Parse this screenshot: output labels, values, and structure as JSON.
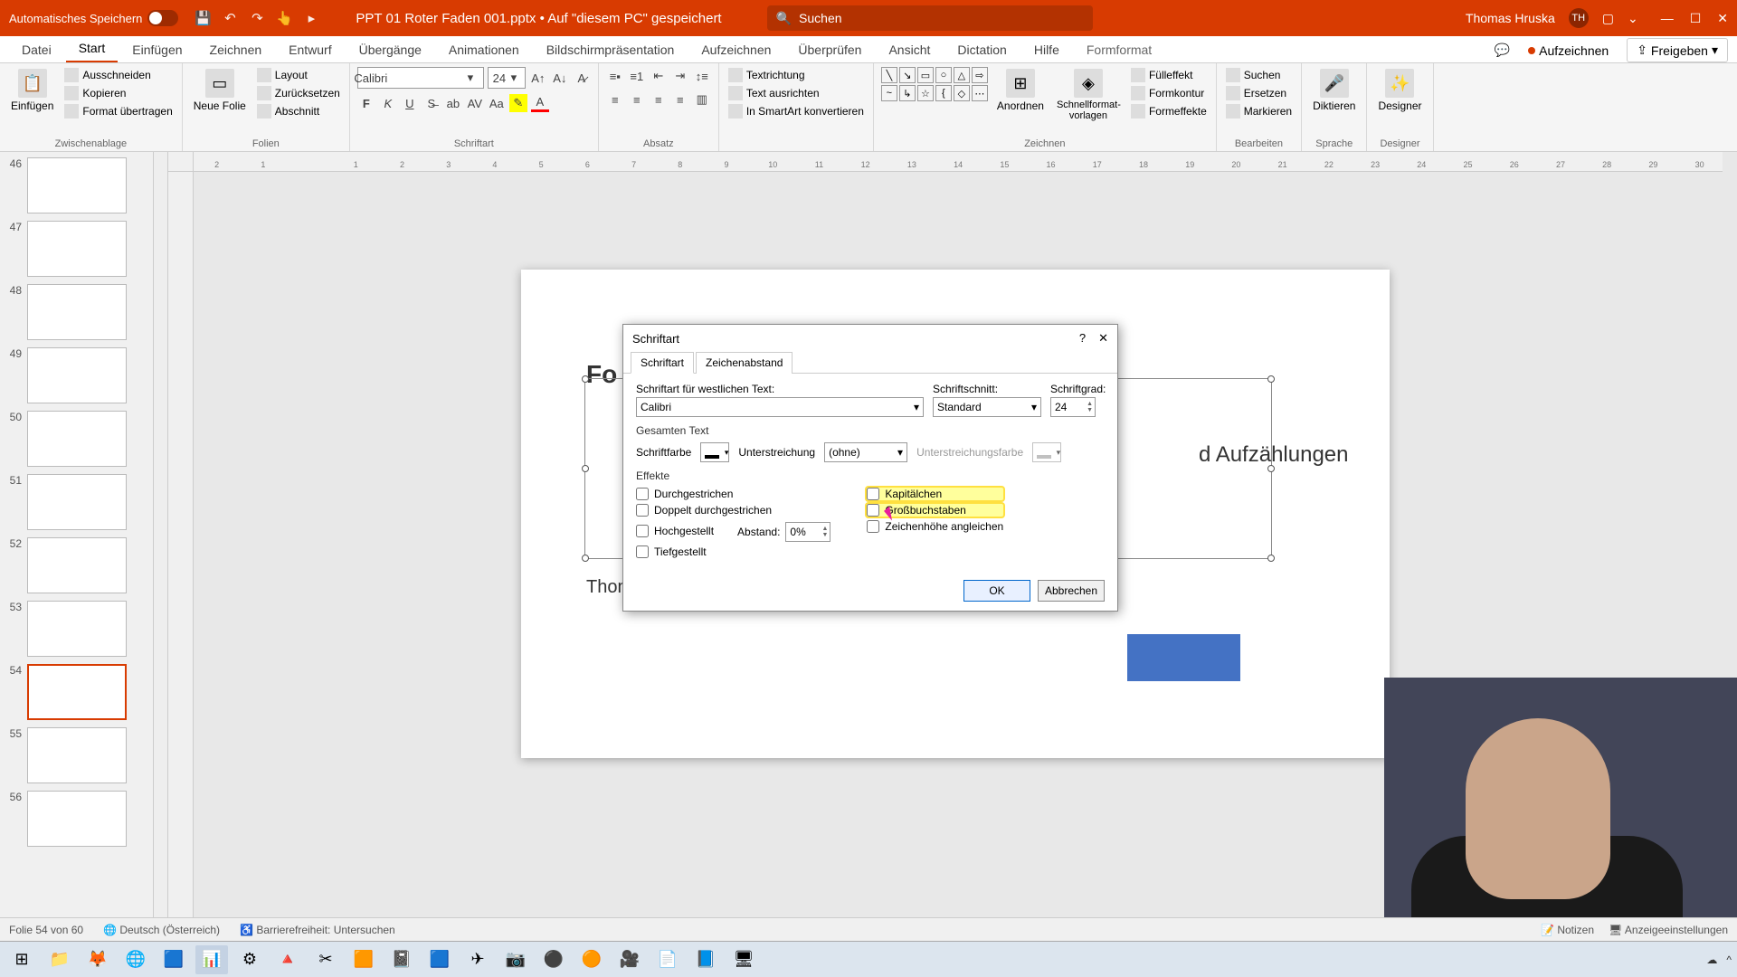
{
  "titlebar": {
    "autosave_label": "Automatisches Speichern",
    "doc_name": "PPT 01 Roter Faden 001.pptx • Auf \"diesem PC\" gespeichert",
    "search_placeholder": "Suchen",
    "user_name": "Thomas Hruska",
    "user_initials": "TH"
  },
  "ribbon_tabs": [
    "Datei",
    "Start",
    "Einfügen",
    "Zeichnen",
    "Entwurf",
    "Übergänge",
    "Animationen",
    "Bildschirmpräsentation",
    "Aufzeichnen",
    "Überprüfen",
    "Ansicht",
    "Dictation",
    "Hilfe",
    "Formformat"
  ],
  "ribbon_actions": {
    "record": "Aufzeichnen",
    "share": "Freigeben"
  },
  "ribbon": {
    "paste": "Einfügen",
    "cut": "Ausschneiden",
    "copy": "Kopieren",
    "format_painter": "Format übertragen",
    "clipboard_label": "Zwischenablage",
    "new_slide": "Neue Folie",
    "layout": "Layout",
    "reset": "Zurücksetzen",
    "section": "Abschnitt",
    "slides_label": "Folien",
    "font_name": "Calibri",
    "font_size": "24",
    "font_label": "Schriftart",
    "paragraph_label": "Absatz",
    "text_direction": "Textrichtung",
    "align_text": "Text ausrichten",
    "convert_smartart": "In SmartArt konvertieren",
    "arrange": "Anordnen",
    "quick_styles": "Schnellformat-vorlagen",
    "shape_fill": "Fülleffekt",
    "shape_outline": "Formkontur",
    "shape_effects": "Formeffekte",
    "draw_label": "Zeichnen",
    "find": "Suchen",
    "replace": "Ersetzen",
    "select": "Markieren",
    "editing_label": "Bearbeiten",
    "dictate": "Diktieren",
    "voice_label": "Sprache",
    "designer": "Designer",
    "designer_label": "Designer"
  },
  "thumbs": [
    {
      "n": "46",
      "text": ""
    },
    {
      "n": "47",
      "text": ""
    },
    {
      "n": "48",
      "text": ""
    },
    {
      "n": "49",
      "text": ""
    },
    {
      "n": "50",
      "text": ""
    },
    {
      "n": "51",
      "text": ""
    },
    {
      "n": "52",
      "text": ""
    },
    {
      "n": "53",
      "text": ""
    },
    {
      "n": "54",
      "text": "",
      "active": true
    },
    {
      "n": "55",
      "text": ""
    },
    {
      "n": "56",
      "text": ""
    }
  ],
  "slide": {
    "title_partial_left": "Fo",
    "title_partial_right": "d Aufzählungen",
    "subtitle": "Thomas Hruska"
  },
  "dialog": {
    "title": "Schriftart",
    "tabs": [
      "Schriftart",
      "Zeichenabstand"
    ],
    "font_western_label": "Schriftart für westlichen Text:",
    "font_western_value": "Calibri",
    "font_style_label": "Schriftschnitt:",
    "font_style_value": "Standard",
    "font_size_label": "Schriftgrad:",
    "font_size_value": "24",
    "all_text_label": "Gesamten Text",
    "font_color_label": "Schriftfarbe",
    "underline_label": "Unterstreichung",
    "underline_value": "(ohne)",
    "underline_color_label": "Unterstreichungsfarbe",
    "effects_label": "Effekte",
    "eff_strike": "Durchgestrichen",
    "eff_dstrike": "Doppelt durchgestrichen",
    "eff_super": "Hochgestellt",
    "eff_sub": "Tiefgestellt",
    "eff_smallcaps": "Kapitälchen",
    "eff_allcaps": "Großbuchstaben",
    "eff_equalize": "Zeichenhöhe angleichen",
    "offset_label": "Abstand:",
    "offset_value": "0%",
    "ok": "OK",
    "cancel": "Abbrechen"
  },
  "statusbar": {
    "slide_info": "Folie 54 von 60",
    "language": "Deutsch (Österreich)",
    "accessibility": "Barrierefreiheit: Untersuchen",
    "notes": "Notizen",
    "display_settings": "Anzeigeeinstellungen"
  },
  "ruler_ticks": [
    "2",
    "1",
    "",
    "1",
    "2",
    "3",
    "4",
    "5",
    "6",
    "7",
    "8",
    "9",
    "10",
    "11",
    "12",
    "13",
    "14",
    "15",
    "16",
    "17",
    "18",
    "19",
    "20",
    "21",
    "22",
    "23",
    "24",
    "25",
    "26",
    "27",
    "28",
    "29",
    "30"
  ]
}
